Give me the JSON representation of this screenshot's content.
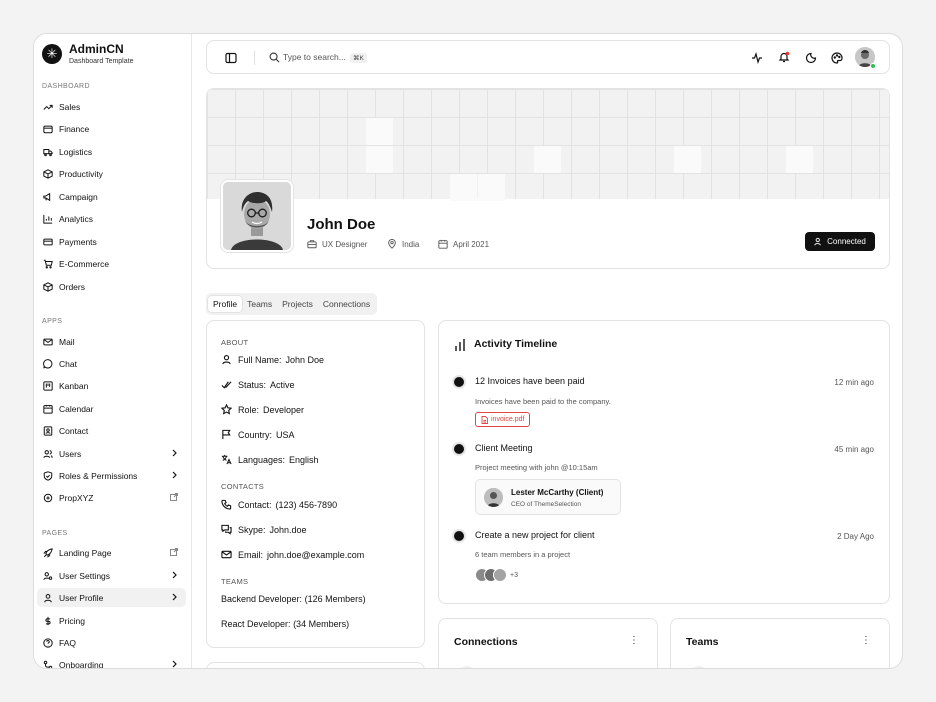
{
  "brand": {
    "name": "AdminCN",
    "subtitle": "Dashboard Template"
  },
  "sidebar": {
    "sections": [
      {
        "title": "DASHBOARD",
        "items": [
          "Sales",
          "Finance",
          "Logistics",
          "Productivity",
          "Campaign",
          "Analytics",
          "Payments",
          "E-Commerce",
          "Orders"
        ]
      },
      {
        "title": "APPS",
        "items": [
          "Mail",
          "Chat",
          "Kanban",
          "Calendar",
          "Contact",
          "Users",
          "Roles & Permissions",
          "PropXYZ"
        ]
      },
      {
        "title": "PAGES",
        "items": [
          "Landing Page",
          "User Settings",
          "User Profile",
          "Pricing",
          "FAQ",
          "Onboarding"
        ]
      }
    ],
    "active_item": "User Profile"
  },
  "topbar": {
    "search_placeholder": "Type to search...",
    "shortcut": "⌘K"
  },
  "profile": {
    "name": "John Doe",
    "role": "UX Designer",
    "location": "India",
    "joined": "April 2021",
    "status_button": "Connected"
  },
  "tabs": [
    "Profile",
    "Teams",
    "Projects",
    "Connections"
  ],
  "about": {
    "about_title": "ABOUT",
    "full_name": {
      "label": "Full Name:",
      "value": "John Doe"
    },
    "status": {
      "label": "Status:",
      "value": "Active"
    },
    "role": {
      "label": "Role:",
      "value": "Developer"
    },
    "country": {
      "label": "Country:",
      "value": "USA"
    },
    "languages": {
      "label": "Languages:",
      "value": "English"
    },
    "contacts_title": "CONTACTS",
    "contact": {
      "label": "Contact:",
      "value": "(123) 456-7890"
    },
    "skype": {
      "label": "Skype:",
      "value": "John.doe"
    },
    "email": {
      "label": "Email:",
      "value": "john.doe@example.com"
    },
    "teams_title": "TEAMS",
    "team1": {
      "label": "Backend Developer:",
      "value": "(126 Members)"
    },
    "team2": {
      "label": "React Developer:",
      "value": "(34 Members)"
    }
  },
  "timeline": {
    "title": "Activity Timeline",
    "events": [
      {
        "title": "12 Invoices have been paid",
        "time": "12 min ago",
        "desc": "Invoices have been paid to the company.",
        "attachment": "invoice.pdf"
      },
      {
        "title": "Client Meeting",
        "time": "45 min ago",
        "desc": "Project meeting with john @10:15am",
        "person_name": "Lester McCarthy (Client)",
        "person_role": "CEO of ThemeSelection"
      },
      {
        "title": "Create a new project for client",
        "time": "2 Day Ago",
        "desc": "6 team members in a project",
        "extra": "+3"
      }
    ]
  },
  "connections": {
    "title": "Connections"
  },
  "teams_card": {
    "title": "Teams"
  }
}
